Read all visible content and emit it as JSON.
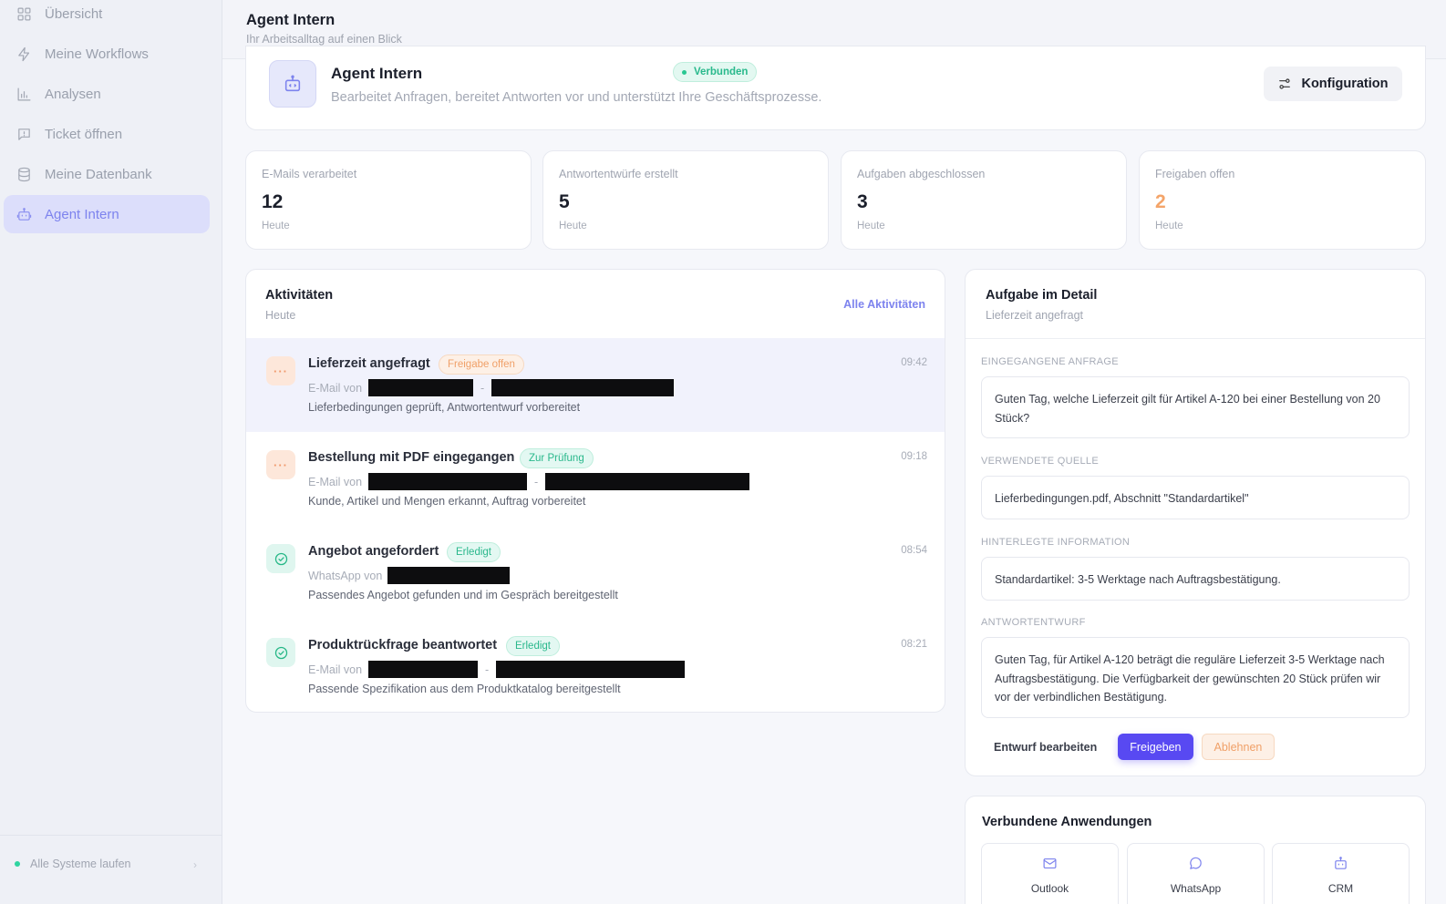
{
  "sidebar": {
    "items": [
      {
        "label": "Übersicht",
        "icon": "grid-icon"
      },
      {
        "label": "Meine Workflows",
        "icon": "bolt-icon"
      },
      {
        "label": "Analysen",
        "icon": "bar-chart-icon"
      },
      {
        "label": "Ticket öffnen",
        "icon": "message-alert-icon"
      },
      {
        "label": "Meine Datenbank",
        "icon": "database-icon"
      },
      {
        "label": "Agent Intern",
        "icon": "robot-icon",
        "active": true
      }
    ],
    "footer": {
      "status": "Alle Systeme laufen"
    }
  },
  "header": {
    "title": "Agent Intern",
    "subtitle": "Ihr Arbeitsalltag auf einen Blick"
  },
  "agent": {
    "name": "Agent Intern",
    "status": "Verbunden",
    "description": "Bearbeitet Anfragen, bereitet Antworten vor und unterstützt Ihre Geschäftsprozesse.",
    "config_label": "Konfiguration"
  },
  "stats": [
    {
      "label": "E-Mails verarbeitet",
      "value": "12",
      "period": "Heute"
    },
    {
      "label": "Antwortentwürfe erstellt",
      "value": "5",
      "period": "Heute"
    },
    {
      "label": "Aufgaben abgeschlossen",
      "value": "3",
      "period": "Heute"
    },
    {
      "label": "Freigaben offen",
      "value": "2",
      "period": "Heute",
      "highlight": "#f4a469"
    }
  ],
  "activities": {
    "title": "Aktivitäten",
    "subtitle": "Heute",
    "all_label": "Alle Aktivitäten",
    "items": [
      {
        "title": "Lieferzeit angefragt",
        "badge": "Freigabe offen",
        "from": "E-Mail von",
        "description": "Lieferbedingungen geprüft, Antwortentwurf vorbereitet",
        "time": "09:42",
        "icon": "more-icon"
      },
      {
        "title": "Bestellung mit PDF eingegangen",
        "badge": "Zur Prüfung",
        "from": "E-Mail von",
        "description": "Kunde, Artikel und Mengen erkannt, Auftrag vorbereitet",
        "time": "09:18",
        "icon": "more-icon"
      },
      {
        "title": "Angebot angefordert",
        "badge": "Erledigt",
        "from": "WhatsApp von",
        "description": "Passendes Angebot gefunden und im Gespräch bereitgestellt",
        "time": "08:54",
        "icon": "check-circle-icon"
      },
      {
        "title": "Produktrückfrage beantwortet",
        "badge": "Erledigt",
        "from": "E-Mail von",
        "description": "Passende Spezifikation aus dem Produktkatalog bereitgestellt",
        "time": "08:21",
        "icon": "check-circle-icon"
      }
    ],
    "more_glyph": "···",
    "separator": "-"
  },
  "detail": {
    "title": "Aufgabe im Detail",
    "subtitle": "Lieferzeit angefragt",
    "sections": [
      {
        "label": "EINGEGANGENE ANFRAGE",
        "text": "Guten Tag, welche Lieferzeit gilt für Artikel A-120 bei einer Bestellung von 20 Stück?"
      },
      {
        "label": "VERWENDETE QUELLE",
        "text": "Lieferbedingungen.pdf, Abschnitt \"Standardartikel\""
      },
      {
        "label": "HINTERLEGTE INFORMATION",
        "text": "Standardartikel: 3-5 Werktage nach Auftragsbestätigung."
      },
      {
        "label": "ANTWORTENTWURF",
        "text": "Guten Tag, für Artikel A-120 beträgt die reguläre Lieferzeit 3-5 Werktage nach Auftragsbestätigung. Die Verfügbarkeit der gewünschten 20 Stück prüfen wir vor der verbindlichen Bestätigung."
      }
    ],
    "edit_label": "Entwurf bearbeiten",
    "approve_label": "Freigeben",
    "reject_label": "Ablehnen"
  },
  "apps": {
    "title": "Verbundene Anwendungen",
    "items": [
      {
        "name": "Outlook",
        "icon": "mail-icon"
      },
      {
        "name": "WhatsApp",
        "icon": "chat-bubble-icon"
      },
      {
        "name": "CRM",
        "icon": "robot-icon"
      }
    ]
  },
  "colors": {
    "accent": "#5849f2",
    "success": "#29c792",
    "warning": "#f4a469"
  }
}
